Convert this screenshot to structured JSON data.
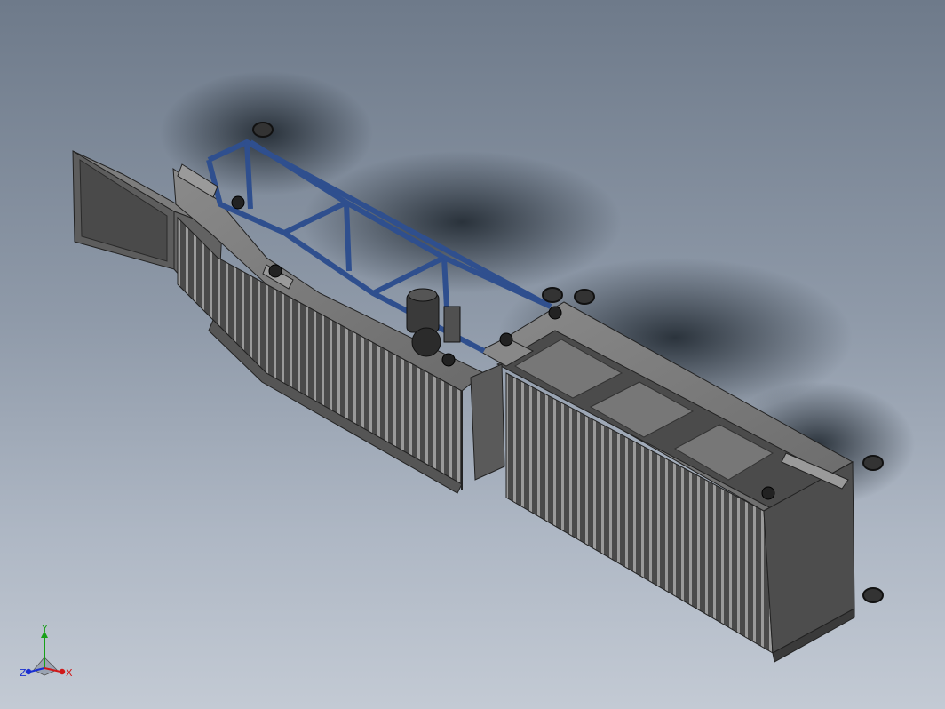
{
  "viewport": {
    "background_top": "#6e7a8a",
    "background_bottom": "#c3cad4"
  },
  "model": {
    "frame_color": "#2f4f8e",
    "steel_light": "#7b7b7b",
    "steel_dark": "#3b3b3b"
  },
  "triad": {
    "x_label": "X",
    "y_label": "Y",
    "z_label": "Z",
    "x_color": "#d01818",
    "y_color": "#18a018",
    "z_color": "#1a2fd0"
  }
}
